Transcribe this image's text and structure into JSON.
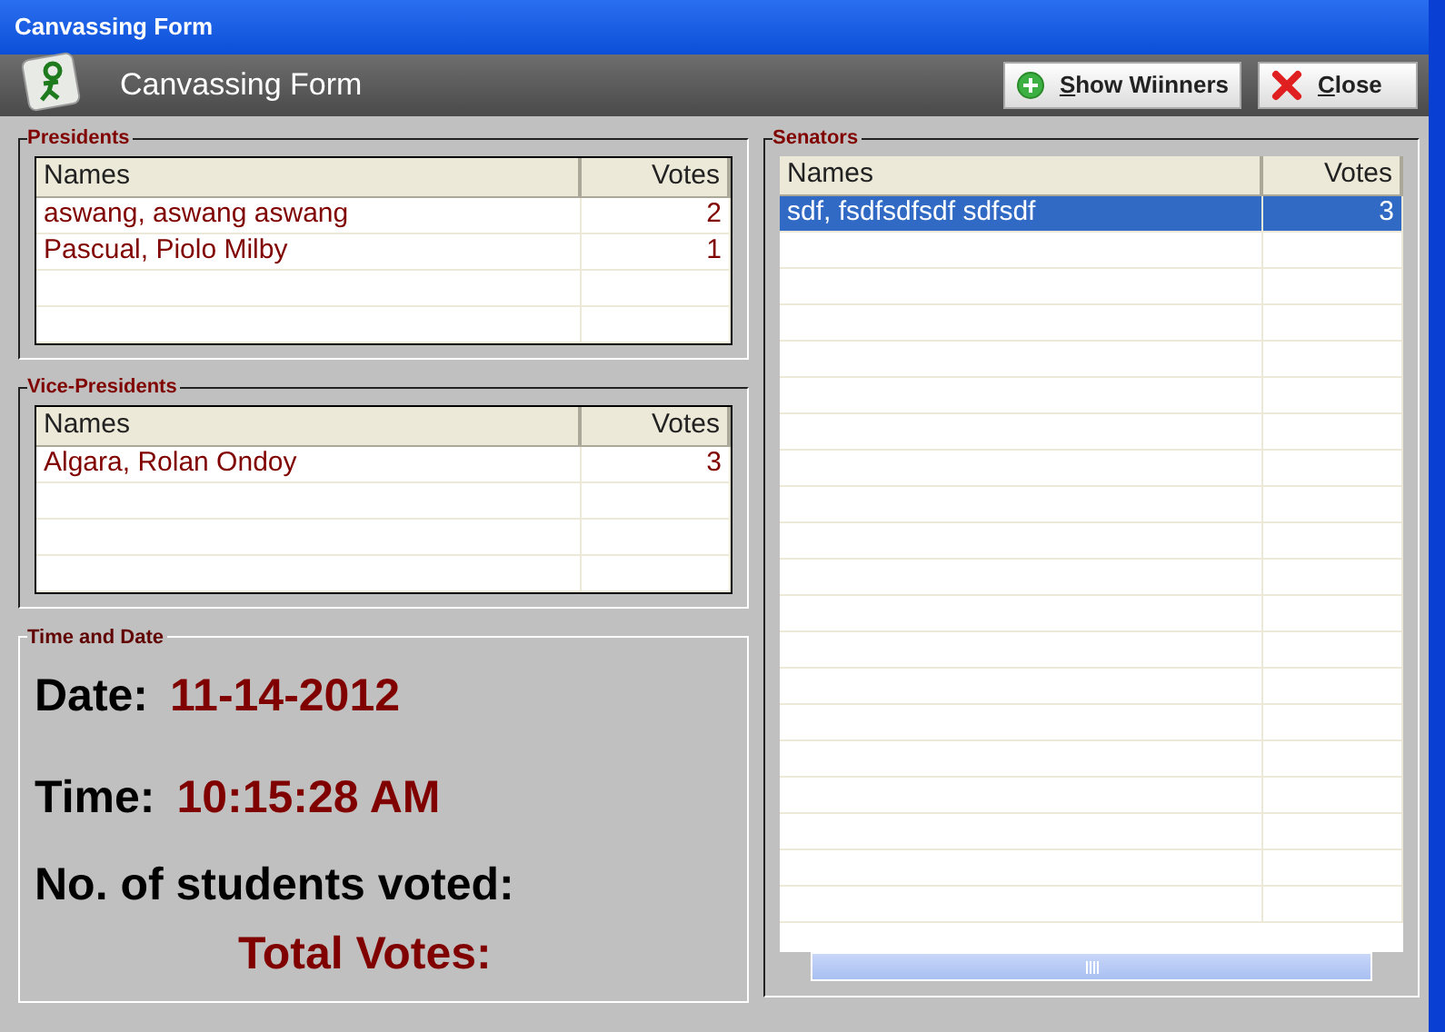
{
  "window": {
    "title": "Canvassing Form"
  },
  "header": {
    "title": "Canvassing Form",
    "buttons": [
      {
        "label": "Show Wiinners",
        "kind": "add"
      },
      {
        "label": "Close",
        "kind": "close"
      }
    ]
  },
  "presidents": {
    "title": "Presidents",
    "columns": [
      "Names",
      "Votes"
    ],
    "rows": [
      {
        "cells": [
          "aswang, aswang aswang",
          "2"
        ],
        "selected": false
      },
      {
        "cells": [
          "Pascual, Piolo Milby",
          "1"
        ],
        "selected": false
      }
    ]
  },
  "vice_presidents": {
    "title": "Vice-Presidents",
    "columns": [
      "Names",
      "Votes"
    ],
    "rows": [
      {
        "cells": [
          "Algara, Rolan Ondoy",
          "3"
        ],
        "selected": false
      }
    ]
  },
  "time_and_date": {
    "title": "Time and Date",
    "date_label": "Date:",
    "date": "11-14-2012",
    "time_label": "Time:",
    "time": "10:15:28 AM",
    "students_label": "No. of students voted:",
    "total_label": "Total Votes:"
  },
  "senators": {
    "title": "Senators",
    "columns": [
      "Names",
      "Votes"
    ],
    "rows": [
      {
        "cells": [
          "sdf, fsdfsdfsdf sdfsdf",
          "3"
        ],
        "selected": true
      }
    ]
  }
}
